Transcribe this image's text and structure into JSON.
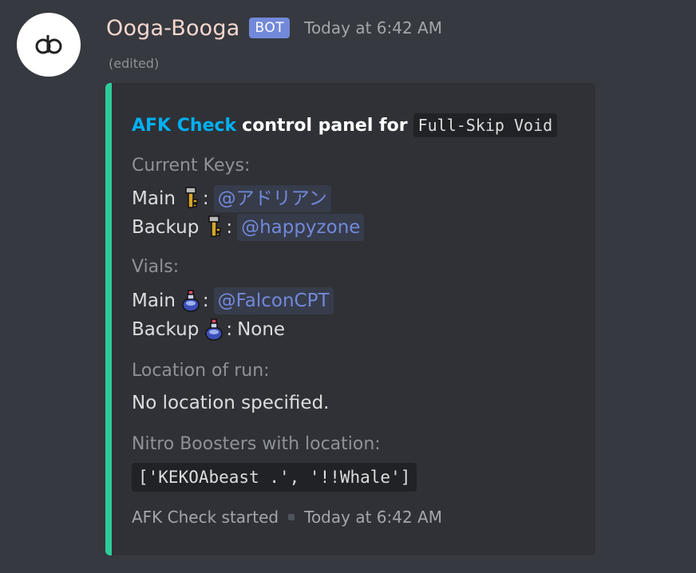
{
  "message": {
    "username": "Ooga-Booga",
    "bot_tag": "BOT",
    "timestamp": "Today at 6:42 AM",
    "edited": "(edited)",
    "accent_color": "#2ecc9b"
  },
  "embed": {
    "title_link": "AFK Check",
    "title_text": "control panel for",
    "title_code": "Full-Skip Void",
    "fields": {
      "keys": {
        "name": "Current Keys:",
        "main_label": "Main",
        "main_icon": "key-icon",
        "main_value": "@アドリアン",
        "backup_label": "Backup",
        "backup_icon": "key-icon",
        "backup_value": "@happyzone"
      },
      "vials": {
        "name": "Vials:",
        "main_label": "Main",
        "main_icon": "vial-icon",
        "main_value": "@FalconCPT",
        "backup_label": "Backup",
        "backup_icon": "vial-icon",
        "backup_value": "None"
      },
      "location": {
        "name": "Location of run:",
        "value": "No location specified."
      },
      "boosters": {
        "name": "Nitro Boosters with location:",
        "value": "['KEKOAbeast .', '!!Whale']"
      }
    },
    "footer": {
      "text": "AFK Check started",
      "timestamp": "Today at 6:42 AM"
    }
  }
}
